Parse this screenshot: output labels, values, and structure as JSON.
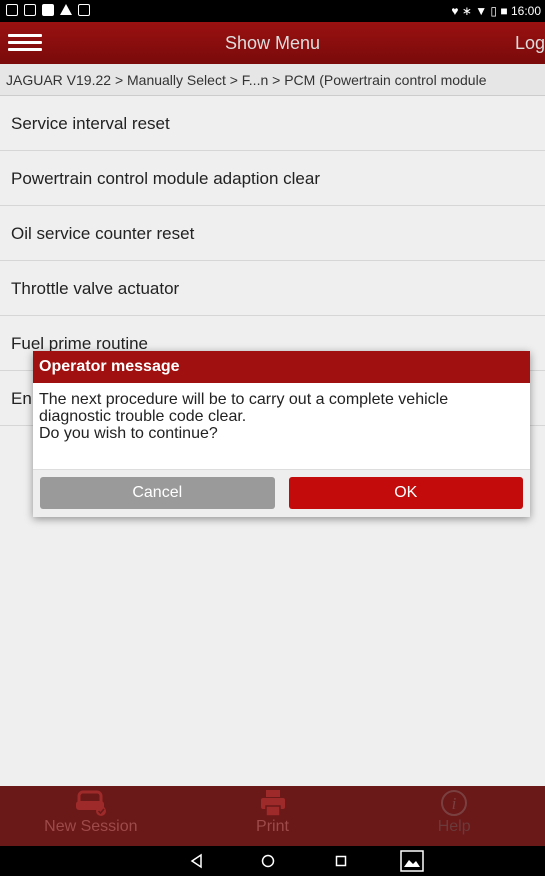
{
  "status_bar": {
    "time": "16:00",
    "icons_right": "♥ ∗ ▼ ▯ ■"
  },
  "app_bar": {
    "title": "Show Menu",
    "login_label": "Logi"
  },
  "breadcrumb": "JAGUAR V19.22 > Manually Select > F...n > PCM (Powertrain control module",
  "menu_items": [
    "Service interval reset",
    "Powertrain control module adaption clear",
    "Oil service counter reset",
    "Throttle valve actuator",
    "Fuel prime routine",
    "En"
  ],
  "dialog": {
    "title": "Operator message",
    "lines": [
      "The next procedure will be to carry out a complete vehicle",
      "diagnostic trouble code clear.",
      "Do you wish to continue?"
    ],
    "cancel_label": "Cancel",
    "ok_label": "OK"
  },
  "bottom_bar": {
    "new_session_label": "New Session",
    "print_label": "Print",
    "help_label": "Help"
  },
  "colors": {
    "accent": "#a01010",
    "ok_button": "#c40b0b",
    "cancel_button": "#9a9a9a"
  }
}
